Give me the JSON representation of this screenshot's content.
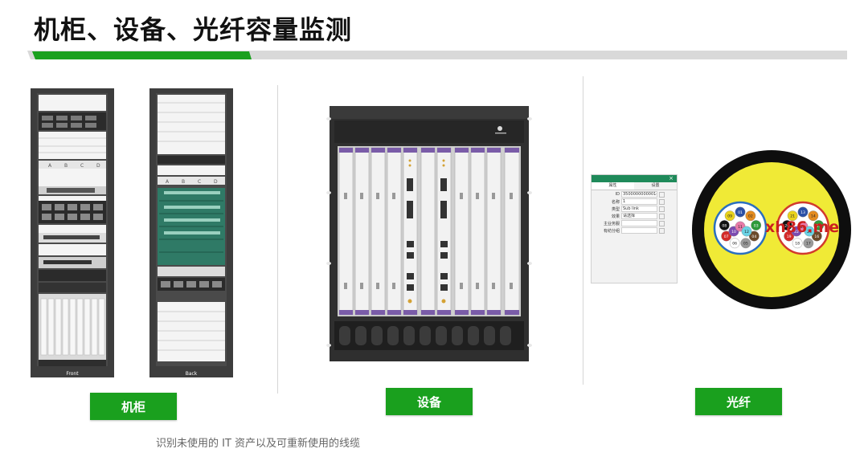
{
  "page": {
    "title": "机柜、设备、光纤容量监测"
  },
  "racks": {
    "slot_letters": [
      "A",
      "B",
      "C",
      "D"
    ],
    "front_label": "Front",
    "back_label": "Back"
  },
  "labels": {
    "cabinet": "机柜",
    "device": "设备",
    "fiber": "光纤"
  },
  "caption": "识别未使用的 IT 资产以及可重新使用的线缆",
  "dialog": {
    "tabs": [
      "属性",
      "设置"
    ],
    "close": "×",
    "rows": [
      {
        "key": "ID",
        "value": "350000000000143"
      },
      {
        "key": "名称",
        "value": "1"
      },
      {
        "key": "类型",
        "value": "Sub link"
      },
      {
        "key": "效果",
        "value": "请选择"
      },
      {
        "key": "主业务服",
        "value": ""
      },
      {
        "key": "有纺分组",
        "value": ""
      }
    ]
  },
  "fiber": {
    "left_tube": [
      "01",
      "02",
      "03",
      "04",
      "05",
      "06",
      "07",
      "08",
      "09",
      "10",
      "11",
      "12"
    ],
    "right_tube": [
      "13",
      "14",
      "15",
      "16",
      "17",
      "18",
      "19",
      "20",
      "21",
      "22",
      "23",
      "24"
    ]
  },
  "watermark": "xh86.me"
}
